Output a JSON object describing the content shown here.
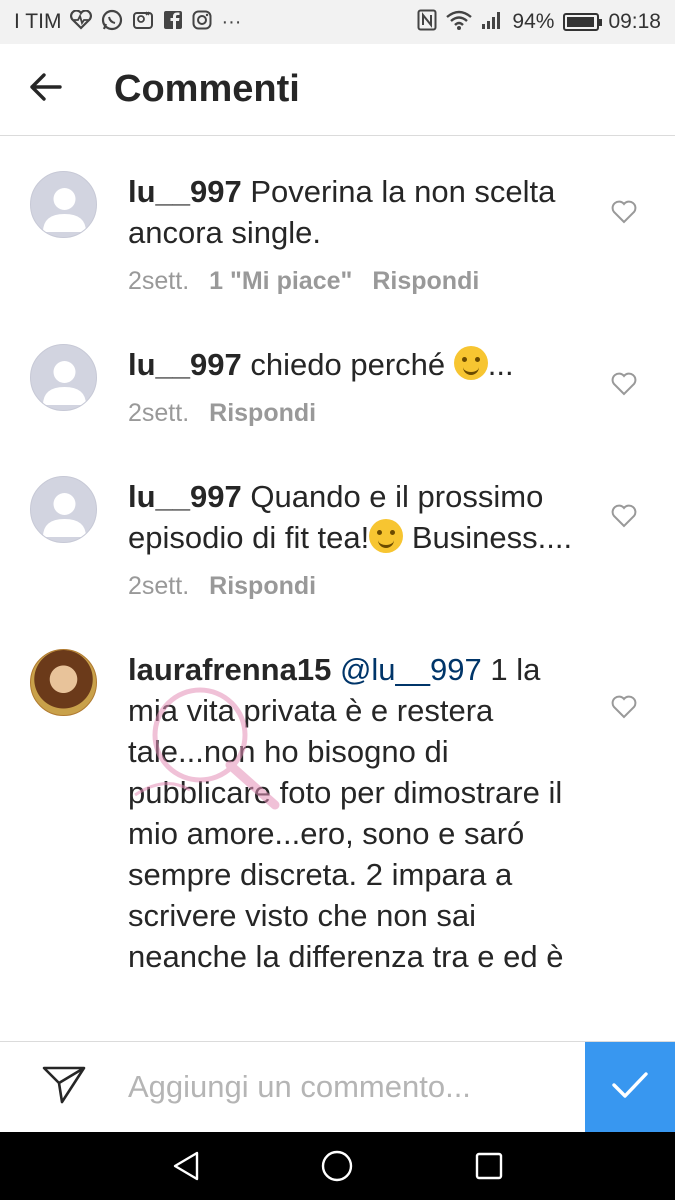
{
  "status_bar": {
    "carrier": "I TIM",
    "notification_icons": [
      "heart-pulse-icon",
      "whatsapp-icon",
      "gallery-icon",
      "facebook-icon",
      "instagram-icon",
      "more-icon"
    ],
    "more": "···",
    "battery": "94%",
    "battery_level": 0.94,
    "time": "09:18"
  },
  "header": {
    "title": "Commenti",
    "back_icon": "arrow-left-icon"
  },
  "comments": [
    {
      "username": "lu__997",
      "text_before": " Poverina la non scelta ancora single.",
      "time": "2sett.",
      "likes": "1 \"Mi piace\"",
      "reply": "Rispondi"
    },
    {
      "username": "lu__997",
      "text_before": " chiedo perché ",
      "emoji": "thinking-face-emoji",
      "text_after": "...",
      "time": "2sett.",
      "reply": "Rispondi"
    },
    {
      "username": "lu__997",
      "text_before": " Quando e il prossimo episodio di fit tea!",
      "emoji": "smiling-face-emoji",
      "text_after": " Business....",
      "time": "2sett.",
      "reply": "Rispondi"
    },
    {
      "username": "laurafrenna15",
      "mention": " @lu__997",
      "text_before": " 1 la mia vita privata è e restera tale...non ho bisogno di pubblicare foto per dimostrare il mio amore...ero, sono e saró sempre discreta. 2 impara a scrivere visto che non sai neanche la differenza tra e ed è"
    }
  ],
  "input_bar": {
    "placeholder": "Aggiungi un commento...",
    "send_icon": "paper-plane-icon",
    "post_icon": "checkmark-icon",
    "post_color": "#3897f0"
  },
  "nav_bar": {
    "icons": [
      "back-triangle-icon",
      "home-circle-icon",
      "recents-square-icon"
    ]
  }
}
